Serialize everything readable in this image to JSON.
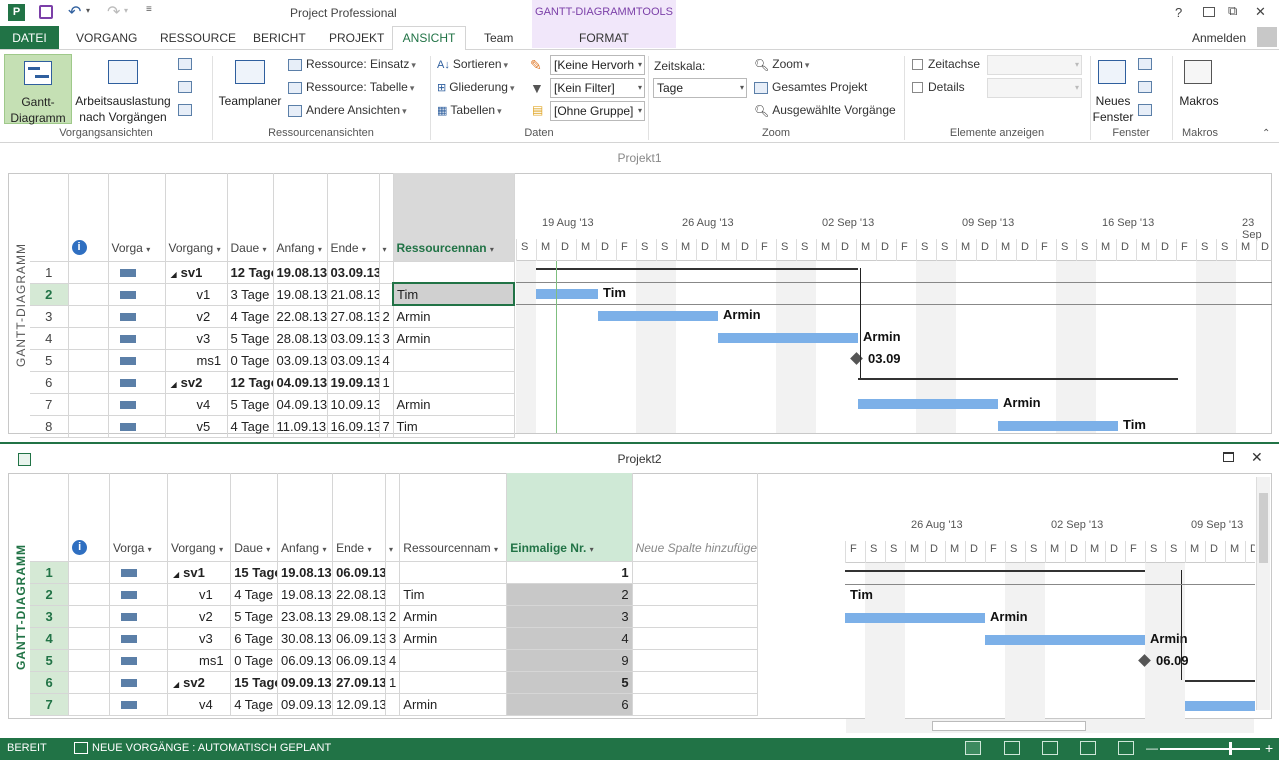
{
  "window": {
    "app_title": "Project Professional",
    "context_tab_title": "GANTT-DIAGRAMMTOOLS",
    "help": "?",
    "restore": "⧉",
    "minimize": "—",
    "close": "✕",
    "signin": "Anmelden"
  },
  "tabs": [
    "DATEI",
    "VORGANG",
    "RESSOURCE",
    "BERICHT",
    "PROJEKT",
    "ANSICHT",
    "Team",
    "FORMAT"
  ],
  "ribbon": {
    "vorgangsansichten": {
      "label": "Vorgangsansichten",
      "gantt": "Gantt-\nDiagramm",
      "gantt_l1": "Gantt-",
      "gantt_l2": "Diagramm",
      "auslastung_l1": "Arbeitsauslastung",
      "auslastung_l2": "nach Vorgängen"
    },
    "ressourcenansichten": {
      "label": "Ressourcenansichten",
      "teamplaner": "Teamplaner",
      "einsatz": "Ressource: Einsatz",
      "tabelle": "Ressource: Tabelle",
      "andere": "Andere Ansichten"
    },
    "daten": {
      "label": "Daten",
      "sortieren": "Sortieren",
      "gliederung": "Gliederung",
      "tabellen": "Tabellen",
      "hervorhebung": "[Keine Hervorh",
      "filter": "[Kein Filter]",
      "gruppe": "[Ohne Gruppe]"
    },
    "zoom": {
      "label": "Zoom",
      "zeitskala": "Zeitskala:",
      "zeitskala_value": "Tage",
      "zoom": "Zoom",
      "gesamtes": "Gesamtes Projekt",
      "ausgewaehlte": "Ausgewählte Vorgänge"
    },
    "elemente": {
      "label": "Elemente anzeigen",
      "zeitachse": "Zeitachse",
      "details": "Details"
    },
    "fenster": {
      "label": "Fenster",
      "neues_l1": "Neues",
      "neues_l2": "Fenster"
    },
    "makros": {
      "label": "Makros",
      "makros": "Makros"
    }
  },
  "project1": {
    "title": "Projekt1",
    "view_label": "GANTT-DIAGRAMM",
    "columns": [
      "Vorga",
      "Vorgang",
      "Daue",
      "Anfang",
      "Ende",
      "",
      "Ressourcennan"
    ],
    "info_icon": "i",
    "rows": [
      {
        "n": "1",
        "name": "sv1",
        "dur": "12 Tage",
        "start": "19.08.13",
        "end": "03.09.13",
        "pred": "",
        "res": "",
        "summary": true
      },
      {
        "n": "2",
        "name": "v1",
        "dur": "3 Tage",
        "start": "19.08.13",
        "end": "21.08.13",
        "pred": "",
        "res": "Tim",
        "summary": false
      },
      {
        "n": "3",
        "name": "v2",
        "dur": "4 Tage",
        "start": "22.08.13",
        "end": "27.08.13",
        "pred": "2",
        "res": "Armin",
        "summary": false
      },
      {
        "n": "4",
        "name": "v3",
        "dur": "5 Tage",
        "start": "28.08.13",
        "end": "03.09.13",
        "pred": "3",
        "res": "Armin",
        "summary": false
      },
      {
        "n": "5",
        "name": "ms1",
        "dur": "0 Tage",
        "start": "03.09.13",
        "end": "03.09.13",
        "pred": "4",
        "res": "",
        "summary": false
      },
      {
        "n": "6",
        "name": "sv2",
        "dur": "12 Tage",
        "start": "04.09.13",
        "end": "19.09.13",
        "pred": "1",
        "res": "",
        "summary": true
      },
      {
        "n": "7",
        "name": "v4",
        "dur": "5 Tage",
        "start": "04.09.13",
        "end": "10.09.13",
        "pred": "",
        "res": "Armin",
        "summary": false
      },
      {
        "n": "8",
        "name": "v5",
        "dur": "4 Tage",
        "start": "11.09.13",
        "end": "16.09.13",
        "pred": "7",
        "res": "Tim",
        "summary": false
      }
    ],
    "weeks": [
      "19 Aug '13",
      "26 Aug '13",
      "02 Sep '13",
      "09 Sep '13",
      "16 Sep '13",
      "23 Sep"
    ],
    "days": [
      "S",
      "M",
      "D",
      "M",
      "D",
      "F",
      "S",
      "S",
      "M",
      "D",
      "M",
      "D",
      "F",
      "S",
      "S",
      "M",
      "D",
      "M",
      "D",
      "F",
      "S",
      "S",
      "M",
      "D",
      "M",
      "D",
      "F",
      "S",
      "S",
      "M",
      "D",
      "M",
      "D",
      "F",
      "S",
      "S",
      "M",
      "D"
    ],
    "bar_labels": {
      "v1": "Tim",
      "v2": "Armin",
      "v3": "Armin",
      "ms1": "03.09",
      "v4": "Armin",
      "v5": "Tim"
    }
  },
  "project2": {
    "title": "Projekt2",
    "view_label": "GANTT-DIAGRAMM",
    "columns": [
      "Vorga",
      "Vorgang",
      "Daue",
      "Anfang",
      "Ende",
      "",
      "Ressourcennam",
      "Einmalige Nr.",
      "Neue Spalte hinzufügen"
    ],
    "info_icon": "i",
    "rows": [
      {
        "n": "1",
        "name": "sv1",
        "dur": "15 Tage",
        "start": "19.08.13",
        "end": "06.09.13",
        "pred": "",
        "res": "",
        "uid": "1",
        "summary": true
      },
      {
        "n": "2",
        "name": "v1",
        "dur": "4 Tage",
        "start": "19.08.13",
        "end": "22.08.13",
        "pred": "",
        "res": "Tim",
        "uid": "2",
        "summary": false
      },
      {
        "n": "3",
        "name": "v2",
        "dur": "5 Tage",
        "start": "23.08.13",
        "end": "29.08.13",
        "pred": "2",
        "res": "Armin",
        "uid": "3",
        "summary": false
      },
      {
        "n": "4",
        "name": "v3",
        "dur": "6 Tage",
        "start": "30.08.13",
        "end": "06.09.13",
        "pred": "3",
        "res": "Armin",
        "uid": "4",
        "summary": false
      },
      {
        "n": "5",
        "name": "ms1",
        "dur": "0 Tage",
        "start": "06.09.13",
        "end": "06.09.13",
        "pred": "4",
        "res": "",
        "uid": "9",
        "summary": false
      },
      {
        "n": "6",
        "name": "sv2",
        "dur": "15 Tage",
        "start": "09.09.13",
        "end": "27.09.13",
        "pred": "1",
        "res": "",
        "uid": "5",
        "summary": true
      },
      {
        "n": "7",
        "name": "v4",
        "dur": "4 Tage",
        "start": "09.09.13",
        "end": "12.09.13",
        "pred": "",
        "res": "Armin",
        "uid": "6",
        "summary": false
      }
    ],
    "weeks": [
      "26 Aug '13",
      "02 Sep '13",
      "09 Sep '13"
    ],
    "days": [
      "F",
      "S",
      "S",
      "M",
      "D",
      "M",
      "D",
      "F",
      "S",
      "S",
      "M",
      "D",
      "M",
      "D",
      "F",
      "S",
      "S",
      "M",
      "D",
      "M",
      "D"
    ],
    "bar_labels": {
      "v1": "Tim",
      "v2": "Armin",
      "v3": "Armin",
      "ms1": "06.09"
    }
  },
  "status": {
    "ready": "BEREIT",
    "new_tasks": "NEUE VORGÄNGE : AUTOMATISCH GEPLANT",
    "minus": "—",
    "plus": "+"
  }
}
